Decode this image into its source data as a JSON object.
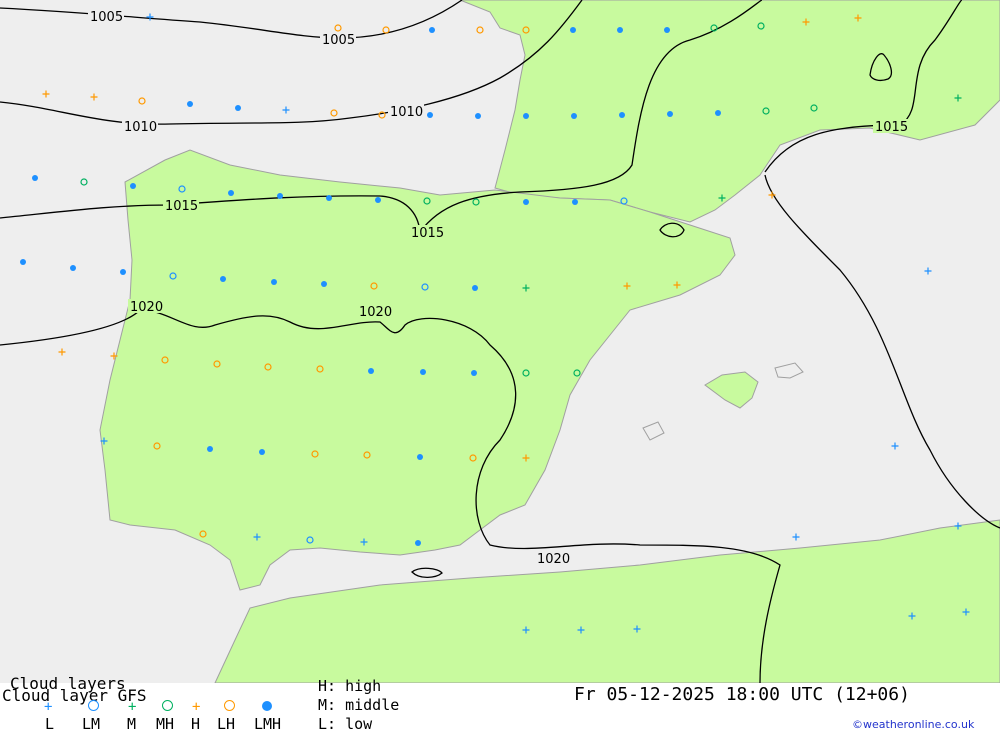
{
  "map": {
    "title_line1": "Cloud layers",
    "title_line2": "Cloud layer  GFS",
    "datetime": "Fr 05-12-2025 18:00 UTC (12+06)",
    "copyright": "©weatheronline.co.uk",
    "key": {
      "high": "H: high",
      "middle": "M: middle",
      "low": "L: low"
    },
    "legend": [
      {
        "label": "L",
        "symbol": "plus",
        "color": "#1e90ff"
      },
      {
        "label": "LM",
        "symbol": "circle",
        "color": "#1e90ff"
      },
      {
        "label": "M",
        "symbol": "plus",
        "color": "#00b060"
      },
      {
        "label": "MH",
        "symbol": "circle",
        "color": "#00b060"
      },
      {
        "label": "H",
        "symbol": "plus",
        "color": "#ff9900"
      },
      {
        "label": "LH",
        "symbol": "circle",
        "color": "#ff9900"
      },
      {
        "label": "LMH",
        "symbol": "dot",
        "color": "#1e90ff"
      }
    ],
    "isobar_labels": [
      "1005",
      "1005",
      "1010",
      "1010",
      "1015",
      "1015",
      "1015",
      "1020",
      "1020",
      "1020"
    ],
    "colors": {
      "sea": "#eeeeee",
      "land": "#c8fa9e",
      "coast": "#a0a0a0",
      "isobar": "#000000",
      "blue": "#1e90ff",
      "green": "#00b060",
      "orange": "#ff9900"
    }
  }
}
